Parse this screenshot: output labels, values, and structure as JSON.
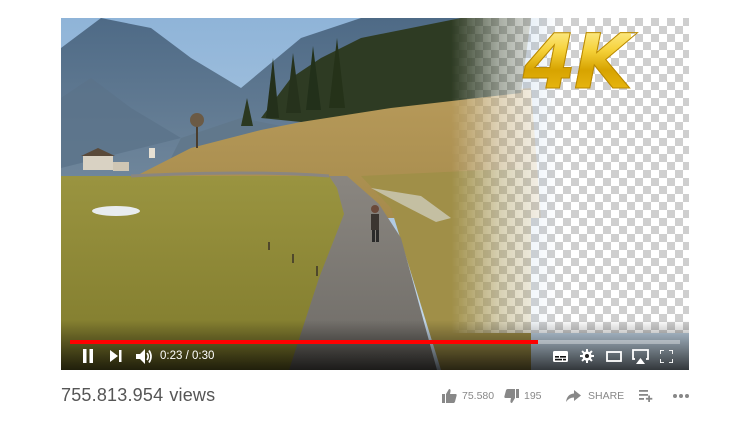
{
  "badge": {
    "text": "4K"
  },
  "player": {
    "current_time": "0:23",
    "separator": " / ",
    "duration": "0:30",
    "progress_fraction": 0.7667,
    "progress_color": "#ff0000"
  },
  "controls": {
    "icons": [
      "pause-icon",
      "next-icon",
      "volume-icon",
      "subtitles-icon",
      "settings-icon",
      "theater-mode-icon",
      "cast-icon",
      "fullscreen-icon"
    ]
  },
  "info": {
    "views_count": "755.813.954",
    "views_label": "views",
    "likes": "75.580",
    "dislikes": "195",
    "share_label": "SHARE"
  }
}
